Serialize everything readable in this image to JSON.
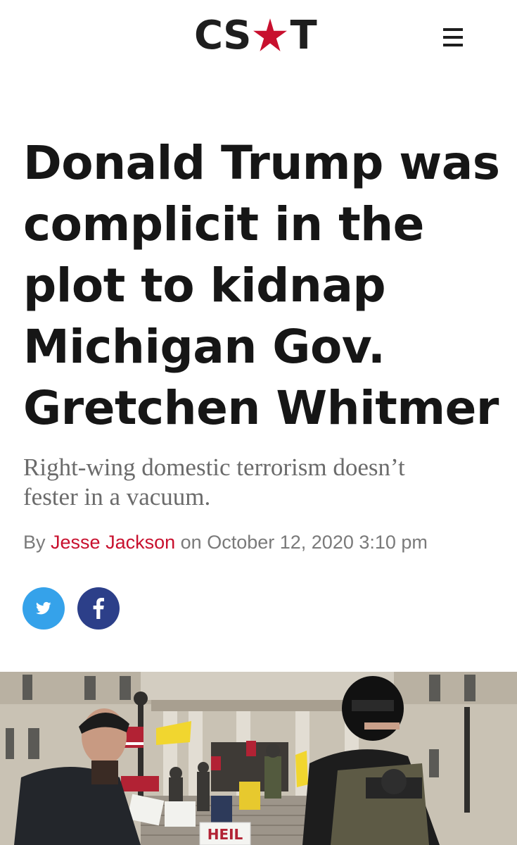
{
  "header": {
    "logo_left": "CS",
    "logo_right": "T",
    "logo_star_icon": "star-icon",
    "menu_icon": "hamburger-menu-icon"
  },
  "article": {
    "headline_lines": [
      "Donald Trump was",
      "complicit in the",
      "plot to kidnap",
      "Michigan Gov.",
      "Gretchen Whitmer"
    ],
    "dek_lines": [
      "Right-wing domestic terrorism doesn’t",
      "fester in a vacuum."
    ],
    "byline": {
      "prefix": "By",
      "author": "Jesse Jackson",
      "connector": "on",
      "date": "October 12, 2020 3:10 pm"
    }
  },
  "share": {
    "twitter_icon": "twitter-icon",
    "facebook_icon": "facebook-icon"
  },
  "photo": {
    "sign_text": "HEIL"
  },
  "colors": {
    "brand_red": "#c8102e",
    "twitter_blue": "#35a2ea",
    "facebook_blue": "#2c3f89",
    "text_dark": "#161616",
    "dek_gray": "#6b6b6b"
  }
}
